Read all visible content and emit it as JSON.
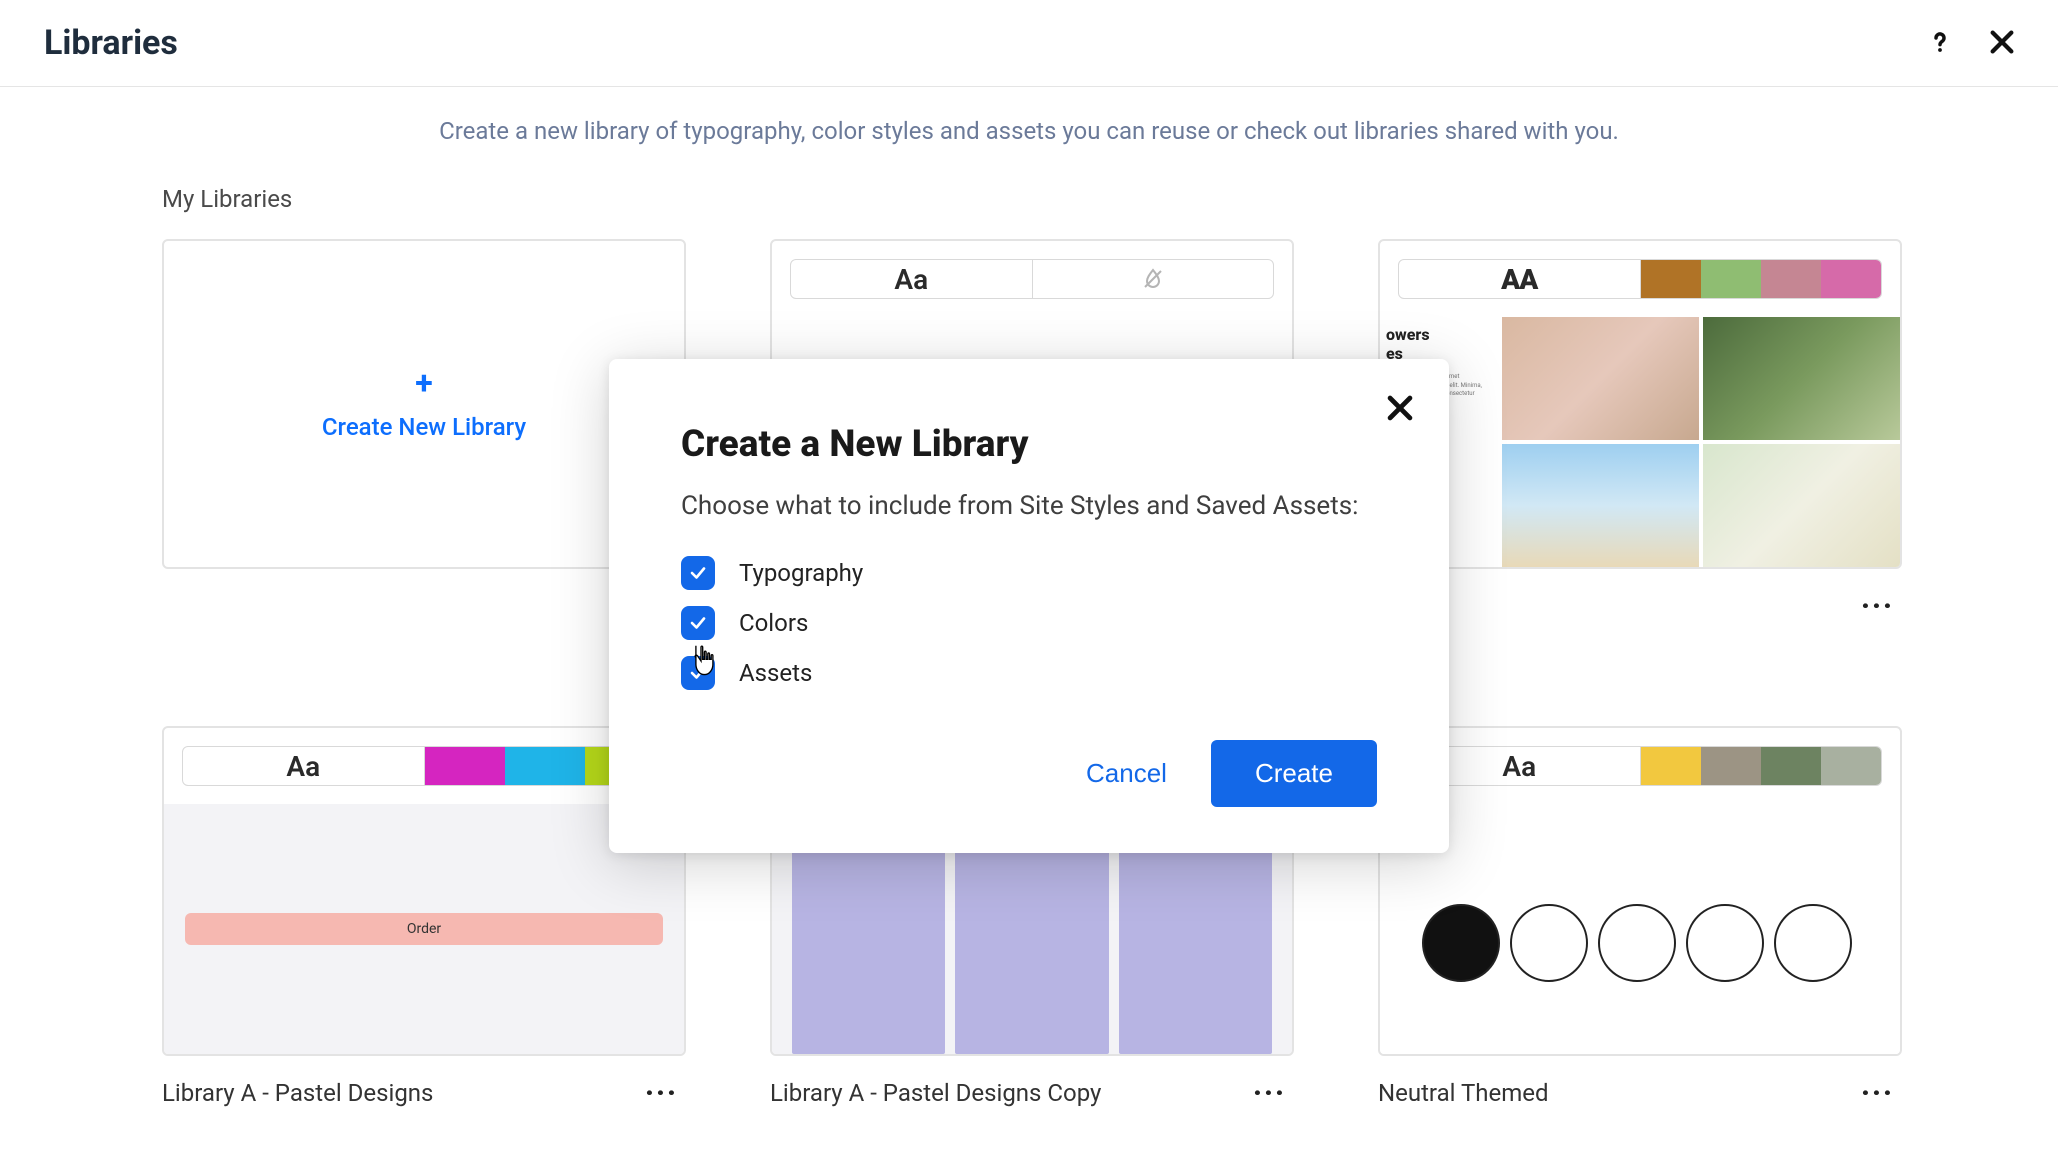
{
  "header": {
    "title": "Libraries"
  },
  "subtitle": "Create a new library of typography, color styles and assets you can reuse or check out libraries shared with you.",
  "section_title": "My Libraries",
  "create_card": {
    "label": "Create New Library"
  },
  "libraries": [
    {
      "name": "",
      "aa_label": "Aa",
      "swatches": [],
      "body_kind": "blank_no_color"
    },
    {
      "name": "",
      "aa_label": "AA",
      "swatches": [
        "#b07326",
        "#8fbd72",
        "#c58693",
        "#d66aa9"
      ],
      "body_kind": "flowers",
      "flowers_heading1": "owers",
      "flowers_heading2": "es"
    },
    {
      "name": "Library A - Pastel Designs",
      "aa_label": "Aa",
      "swatches": [
        "#d525c0",
        "#1fb4e8",
        "#b6d91a"
      ],
      "body_kind": "peach",
      "pill_label": "Order"
    },
    {
      "name": "Library A - Pastel Designs Copy",
      "aa_label": "Aa",
      "swatches": [],
      "body_kind": "lavender"
    },
    {
      "name": "Neutral Themed",
      "aa_label": "Aa",
      "swatches": [
        "#f2c83f",
        "#9c9484",
        "#6d8361",
        "#a8b0a0"
      ],
      "body_kind": "neutral"
    }
  ],
  "modal": {
    "title": "Create a New Library",
    "description": "Choose what to include from Site Styles and Saved Assets:",
    "options": [
      {
        "label": "Typography",
        "checked": true
      },
      {
        "label": "Colors",
        "checked": true
      },
      {
        "label": "Assets",
        "checked": true
      }
    ],
    "cancel_label": "Cancel",
    "create_label": "Create"
  }
}
